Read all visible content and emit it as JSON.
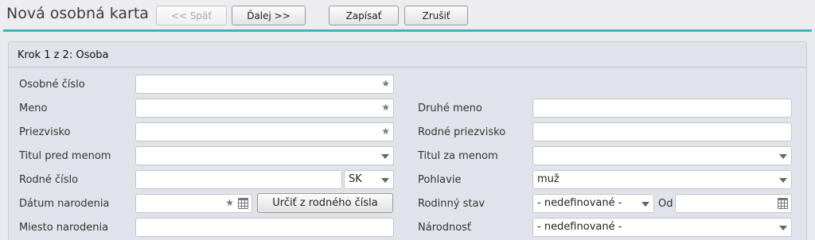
{
  "header": {
    "title": "Nová osobná karta",
    "back_label": "<< Späť",
    "next_label": "Ďalej >>",
    "save_label": "Zapísať",
    "cancel_label": "Zrušiť"
  },
  "panel": {
    "title": "Krok 1 z 2: Osoba"
  },
  "form": {
    "osobne_cislo": {
      "label": "Osobné číslo",
      "value": ""
    },
    "meno": {
      "label": "Meno",
      "value": ""
    },
    "druhe_meno": {
      "label": "Druhé meno",
      "value": ""
    },
    "priezvisko": {
      "label": "Priezvisko",
      "value": ""
    },
    "rodne_priezvisko": {
      "label": "Rodné priezvisko",
      "value": ""
    },
    "titul_pred": {
      "label": "Titul pred menom",
      "value": ""
    },
    "titul_za": {
      "label": "Titul za menom",
      "value": ""
    },
    "rodne_cislo": {
      "label": "Rodné číslo",
      "value": "",
      "country": "SK"
    },
    "pohlavie": {
      "label": "Pohlavie",
      "value": "muž"
    },
    "datum_narodenia": {
      "label": "Dátum narodenia",
      "value": "",
      "button_label": "Určiť z rodného čísla"
    },
    "rodinny_stav": {
      "label": "Rodinný stav",
      "value": "- nedefinované -",
      "od_label": "Od",
      "od_value": ""
    },
    "miesto_narodenia": {
      "label": "Miesto narodenia",
      "value": ""
    },
    "narodnost": {
      "label": "Národnosť",
      "value": "- nedefinované -"
    }
  },
  "icons": {
    "required": "star-icon",
    "dropdown": "caret-down-icon",
    "date": "calendar-icon"
  },
  "colors": {
    "accent": "#3fb4bf",
    "background": "#e9eaee",
    "panel": "#e1e3ea"
  }
}
